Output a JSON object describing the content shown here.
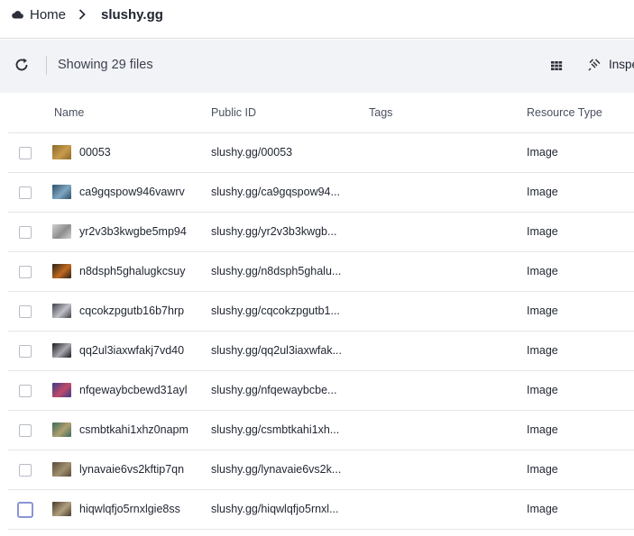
{
  "breadcrumb": {
    "home": "Home",
    "current": "slushy.gg"
  },
  "toolbar": {
    "file_count": "Showing 29 files",
    "inspect_label": "Inspect"
  },
  "table": {
    "columns": {
      "name": "Name",
      "public_id": "Public ID",
      "tags": "Tags",
      "resource_type": "Resource Type"
    },
    "rows": [
      {
        "name": "00053",
        "public_id": "slushy.gg/00053",
        "tags": "",
        "resource_type": "Image",
        "thumb": [
          "#8a6a2a",
          "#c99a4a"
        ]
      },
      {
        "name": "ca9gqspow946vawrv",
        "public_id": "slushy.gg/ca9gqspow94...",
        "tags": "",
        "resource_type": "Image",
        "thumb": [
          "#2f4f6a",
          "#7fa6c0"
        ]
      },
      {
        "name": "yr2v3b3kwgbe5mp94",
        "public_id": "slushy.gg/yr2v3b3kwgb...",
        "tags": "",
        "resource_type": "Image",
        "thumb": [
          "#cfcfcf",
          "#8e8e8e"
        ]
      },
      {
        "name": "n8dsph5ghalugkcsuy",
        "public_id": "slushy.gg/n8dsph5ghalu...",
        "tags": "",
        "resource_type": "Image",
        "thumb": [
          "#2a2018",
          "#c06a20"
        ]
      },
      {
        "name": "cqcokzpgutb16b7hrp",
        "public_id": "slushy.gg/cqcokzpgutb1...",
        "tags": "",
        "resource_type": "Image",
        "thumb": [
          "#404048",
          "#c0c0c8"
        ]
      },
      {
        "name": "qq2ul3iaxwfakj7vd40",
        "public_id": "slushy.gg/qq2ul3iaxwfak...",
        "tags": "",
        "resource_type": "Image",
        "thumb": [
          "#1a1a1e",
          "#a8a8b0"
        ]
      },
      {
        "name": "nfqewaybcbewd31ayl",
        "public_id": "slushy.gg/nfqewaybcbe...",
        "tags": "",
        "resource_type": "Image",
        "thumb": [
          "#3a3a8a",
          "#c04a6a"
        ]
      },
      {
        "name": "csmbtkahi1xhz0napm",
        "public_id": "slushy.gg/csmbtkahi1xh...",
        "tags": "",
        "resource_type": "Image",
        "thumb": [
          "#3a6a5a",
          "#b0a070"
        ]
      },
      {
        "name": "lynavaie6vs2kftip7qn",
        "public_id": "slushy.gg/lynavaie6vs2k...",
        "tags": "",
        "resource_type": "Image",
        "thumb": [
          "#5a4a3a",
          "#a09070"
        ]
      },
      {
        "name": "hiqwlqfjo5rnxlgie8ss",
        "public_id": "slushy.gg/hiqwlqfjo5rnxl...",
        "tags": "",
        "resource_type": "Image",
        "thumb": [
          "#4a3a2a",
          "#b0a080"
        ]
      }
    ]
  }
}
